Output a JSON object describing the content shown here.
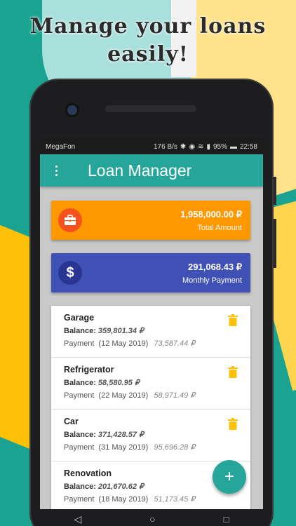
{
  "promo": {
    "headline_line1": "Manage your loans",
    "headline_line2": "easily!"
  },
  "statusbar": {
    "carrier": "MegaFon",
    "speed": "176 B/s",
    "battery": "95%",
    "time": "22:58"
  },
  "app": {
    "title": "Loan Manager",
    "accent": "#26a69a"
  },
  "summary": {
    "total": {
      "amount": "1,958,000.00 ₽",
      "label": "Total Amount",
      "color": "#ff9800",
      "icon": "briefcase-icon"
    },
    "monthly": {
      "amount": "291,068.43 ₽",
      "label": "Monthly Payment",
      "color": "#3f51b5",
      "icon": "dollar-icon"
    }
  },
  "loans": [
    {
      "name": "Garage",
      "balance_label": "Balance:",
      "balance": "359,801.34 ₽",
      "payment_label": "Payment",
      "date": "(12 May 2019)",
      "payment": "73,587.44 ₽"
    },
    {
      "name": "Refrigerator",
      "balance_label": "Balance:",
      "balance": "58,580.95 ₽",
      "payment_label": "Payment",
      "date": "(22 May 2019)",
      "payment": "58,971.49 ₽"
    },
    {
      "name": "Car",
      "balance_label": "Balance:",
      "balance": "371,428.57 ₽",
      "payment_label": "Payment",
      "date": "(31 May 2019)",
      "payment": "95,696.28 ₽"
    },
    {
      "name": "Renovation",
      "balance_label": "Balance:",
      "balance": "201,670.62 ₽",
      "payment_label": "Payment",
      "date": "(18 May 2019)",
      "payment": "51,173.45 ₽"
    }
  ],
  "fab": {
    "label": "+"
  }
}
